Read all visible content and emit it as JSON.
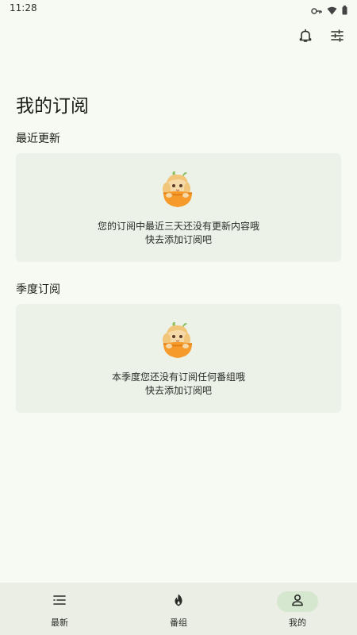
{
  "status_bar": {
    "time": "11:28",
    "icons": [
      "key-icon",
      "wifi-icon",
      "battery-icon"
    ]
  },
  "header": {
    "actions": [
      {
        "icon": "bell-icon"
      },
      {
        "icon": "filter-sliders-icon"
      }
    ]
  },
  "page": {
    "title": "我的订阅"
  },
  "sections": [
    {
      "title": "最近更新",
      "empty_line1": "您的订阅中最近三天还没有更新内容哦",
      "empty_line2": "快去添加订阅吧"
    },
    {
      "title": "季度订阅",
      "empty_line1": "本季度您还没有订阅任何番组哦",
      "empty_line2": "快去添加订阅吧"
    }
  ],
  "bottom_nav": {
    "items": [
      {
        "label": "最新",
        "icon": "list-icon",
        "active": false
      },
      {
        "label": "番组",
        "icon": "fire-icon",
        "active": false
      },
      {
        "label": "我的",
        "icon": "person-icon",
        "active": true
      }
    ]
  },
  "colors": {
    "background": "#f7faf2",
    "card": "#ecf2e7",
    "nav_background": "#ebeee5",
    "nav_active_pill": "#d5e8cf",
    "text": "#1b1c18"
  }
}
